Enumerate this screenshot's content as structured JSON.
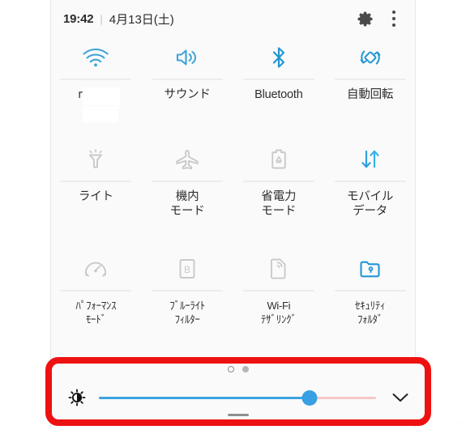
{
  "header": {
    "time": "19:42",
    "separator": "|",
    "date": "4月13日(土)",
    "settings_icon": "gear-icon",
    "overflow_icon": "kebab-menu-icon"
  },
  "tiles": [
    [
      {
        "icon": "wifi-icon",
        "label": "rv          -502",
        "state": "on",
        "color": "#3ba3d8",
        "redacted": true
      },
      {
        "icon": "sound-icon",
        "label": "サウンド",
        "state": "on",
        "color": "#3ba3d8"
      },
      {
        "icon": "bluetooth-icon",
        "label": "Bluetooth",
        "state": "on",
        "color": "#2196d4"
      },
      {
        "icon": "auto-rotate-icon",
        "label": "自動回転",
        "state": "on",
        "color": "#2196d4"
      }
    ],
    [
      {
        "icon": "flashlight-icon",
        "label": "ライト",
        "state": "off",
        "color": "#c9c9c9"
      },
      {
        "icon": "airplane-mode-icon",
        "label": "機内\nモード",
        "state": "off",
        "color": "#c9c9c9"
      },
      {
        "icon": "power-saving-icon",
        "label": "省電力\nモード",
        "state": "off",
        "color": "#c9c9c9"
      },
      {
        "icon": "mobile-data-icon",
        "label": "モバイル\nデータ",
        "state": "on",
        "color": "#2e9fe0"
      }
    ],
    [
      {
        "icon": "performance-mode-icon",
        "label": "ﾊﾟﾌｫｰﾏﾝｽ\nﾓｰﾄﾞ",
        "state": "off",
        "color": "#c9c9c9",
        "compact": true
      },
      {
        "icon": "blue-light-filter-icon",
        "label": "ﾌﾞﾙｰﾗｲﾄ\nﾌｨﾙﾀｰ",
        "state": "off",
        "color": "#c9c9c9",
        "compact": true
      },
      {
        "icon": "wifi-tethering-icon",
        "label": "Wi-Fi\nﾃｻﾞﾘﾝｸﾞ",
        "state": "off",
        "color": "#c9c9c9",
        "compact": true
      },
      {
        "icon": "secure-folder-icon",
        "label": "ｾｷｭﾘﾃｨ\nﾌｫﾙﾀﾞ",
        "state": "on",
        "color": "#2196d4",
        "compact": true
      }
    ]
  ],
  "brightness": {
    "icon": "auto-brightness-icon",
    "value_percent": 76,
    "track_filled_color": "#3ba3e0",
    "track_remaining_color": "#f7c9c9",
    "thumb_color": "#38a0e3",
    "expand_icon": "chevron-down-icon",
    "highlight_color": "#ee1111"
  },
  "page_indicator": {
    "dots": [
      "current",
      "other"
    ],
    "count": 2
  }
}
